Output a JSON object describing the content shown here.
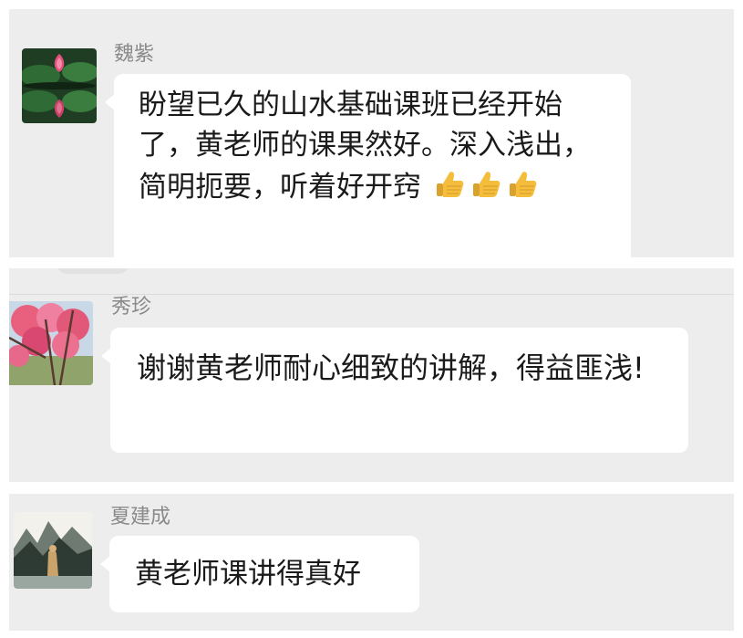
{
  "messages": [
    {
      "sender": "魏紫",
      "avatar": "lotus-flower-avatar",
      "text": "盼望已久的山水基础课班已经开始了，黄老师的课果然好。深入浅出，简明扼要，听着好开窍",
      "emoji": [
        "thumbs-up-icon",
        "thumbs-up-icon",
        "thumbs-up-icon"
      ]
    },
    {
      "sender": "秀珍",
      "avatar": "pink-blossom-tree-avatar",
      "text": "谢谢黄老师耐心细致的讲解，得益匪浅!"
    },
    {
      "sender": "夏建成",
      "avatar": "ink-landscape-painting-avatar",
      "text": "黄老师课讲得真好"
    }
  ],
  "colors": {
    "panel_background": "#ededed",
    "bubble_background": "#ffffff",
    "sender_name": "#8a8a8a",
    "message_text": "#1a1a1a",
    "emoji_yellow": "#f5bd3c"
  }
}
